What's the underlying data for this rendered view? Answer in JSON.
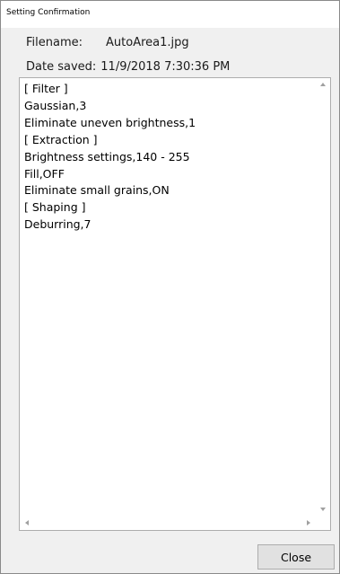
{
  "window": {
    "title": "Setting Confirmation"
  },
  "info": {
    "filename_label": "Filename:",
    "filename_value": "AutoArea1.jpg",
    "date_label": "Date saved:",
    "date_value": "11/9/2018 7:30:36 PM"
  },
  "content": {
    "lines": [
      "[ Filter ]",
      "Gaussian,3",
      "Eliminate uneven brightness,1",
      "[ Extraction ]",
      "Brightness settings,140 - 255",
      "Fill,OFF",
      "Eliminate small grains,ON",
      "[ Shaping ]",
      "Deburring,7"
    ]
  },
  "buttons": {
    "close_label": "Close"
  }
}
